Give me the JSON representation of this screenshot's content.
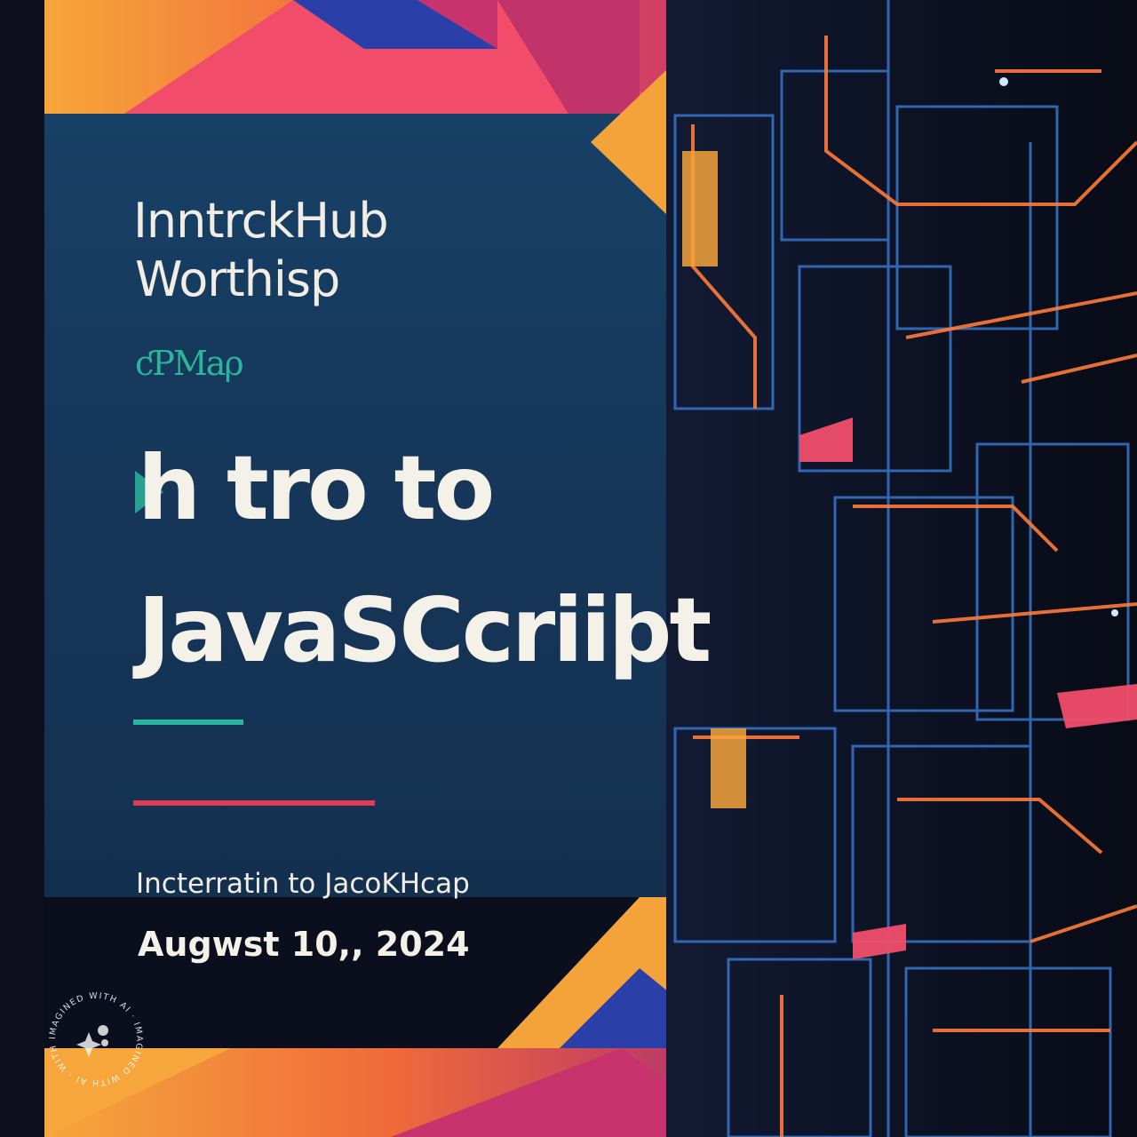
{
  "organizer": {
    "name": "InntrckHub",
    "subline": "Worthisp",
    "logo_text": "cƤMaρ"
  },
  "title": {
    "line1": "h tro to",
    "line2": "JavaSCcriiþt"
  },
  "subtitle": "Incterratin to JacoKHcap",
  "date": "Augwst 10,, 2024",
  "watermark": {
    "text": "IMAGINED WITH AI · IMAGINED WITH AI · WITH AI",
    "icon": "sparkle-icon"
  },
  "colors": {
    "panel": "#173a5e",
    "accent_green": "#2bb59a",
    "accent_red": "#e23a58",
    "orange": "#f4a33a",
    "magenta": "#c8336d",
    "pink": "#f14d6a",
    "blue": "#2a3fa8",
    "neon_orange": "#ff7a3a",
    "neon_blue": "#3a7bd5"
  }
}
